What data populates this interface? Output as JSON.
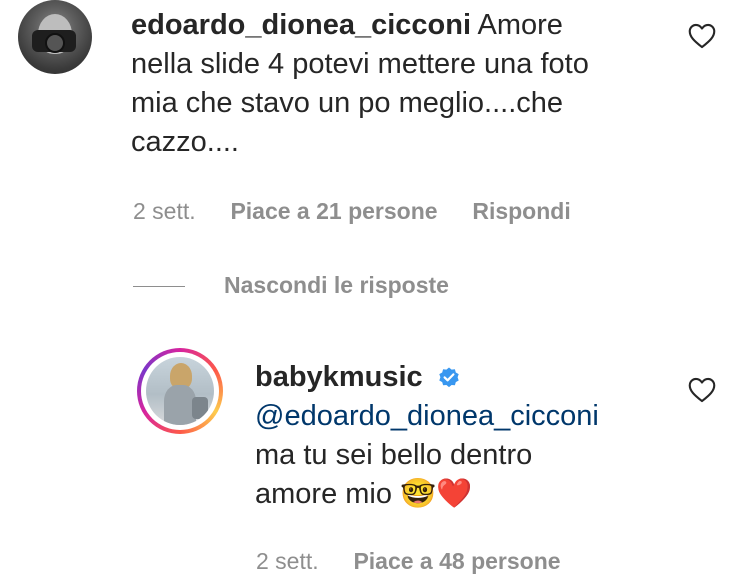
{
  "comment": {
    "username": "edoardo_dionea_cicconi",
    "text_line1": "Amore",
    "text_line2": "nella slide 4 potevi mettere una foto",
    "text_line3": "mia che stavo un po meglio....che",
    "text_line4": "cazzo....",
    "time": "2 sett.",
    "likes": "Piace a 21 persone",
    "reply": "Rispondi"
  },
  "replies_toggle": "Nascondi le risposte",
  "reply": {
    "username": "babykmusic",
    "mention": "@edoardo_dionea_cicconi",
    "text_line1": "ma tu sei bello dentro",
    "text_line2": "amore mio",
    "emoji": "🤓❤️",
    "time": "2 sett.",
    "likes": "Piace a 48 persone"
  },
  "colors": {
    "text": "#262626",
    "meta": "#8e8e8e",
    "mention": "#00376b",
    "verified": "#3897f0",
    "heart_emoji": "#e0245e"
  },
  "icons": [
    "heart-outline-icon",
    "verified-badge-icon"
  ]
}
